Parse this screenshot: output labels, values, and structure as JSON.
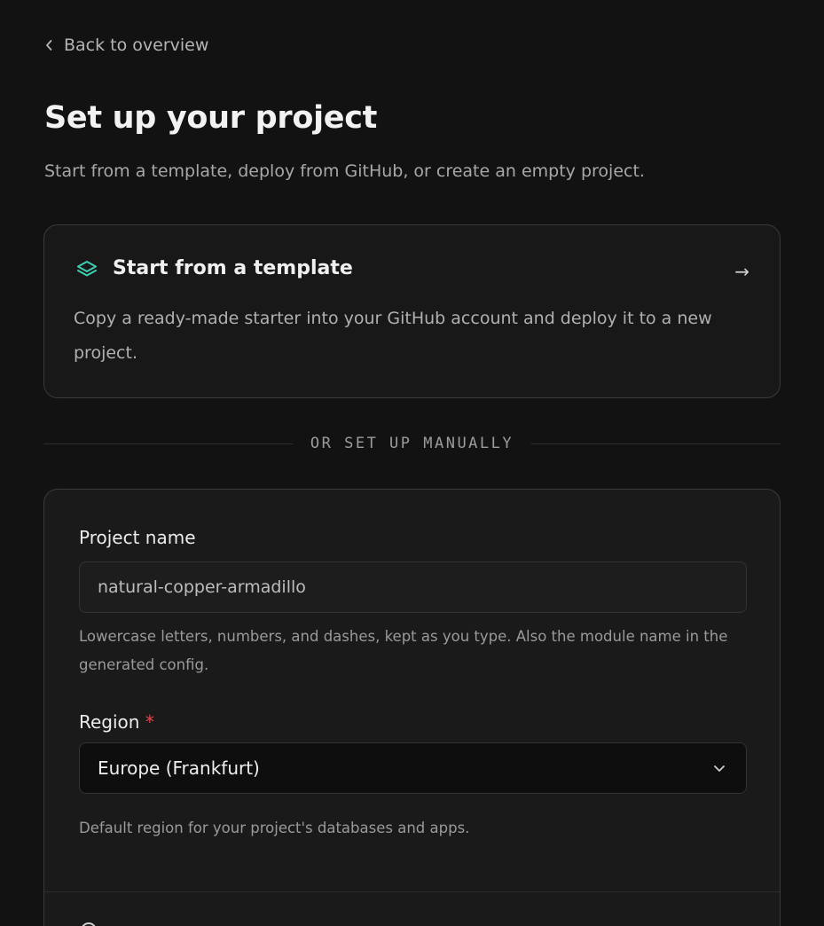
{
  "back_link": {
    "label": "Back to overview",
    "icon": "chevron-left-icon"
  },
  "page": {
    "title": "Set up your project",
    "subtitle": "Start from a template, deploy from GitHub, or create an empty project."
  },
  "template_card": {
    "icon": "layers-icon",
    "title": "Start from a template",
    "arrow": "→",
    "description": "Copy a ready-made starter into your GitHub account and deploy it to a new project.",
    "accent_color": "#3ecfb2"
  },
  "divider": {
    "label": "OR SET UP MANUALLY"
  },
  "form": {
    "project_name": {
      "label": "Project name",
      "value": "natural-copper-armadillo",
      "hint": "Lowercase letters, numbers, and dashes, kept as you type. Also the module name in the generated config."
    },
    "region": {
      "label": "Region",
      "required_mark": "*",
      "selected": "Europe (Frankfurt)",
      "hint": "Default region for your project's databases and apps."
    }
  },
  "colors": {
    "background": "#121212",
    "card": "#1a1a1a",
    "border": "#3a3a3a",
    "accent": "#3ecfb2",
    "required": "#e5484d"
  }
}
